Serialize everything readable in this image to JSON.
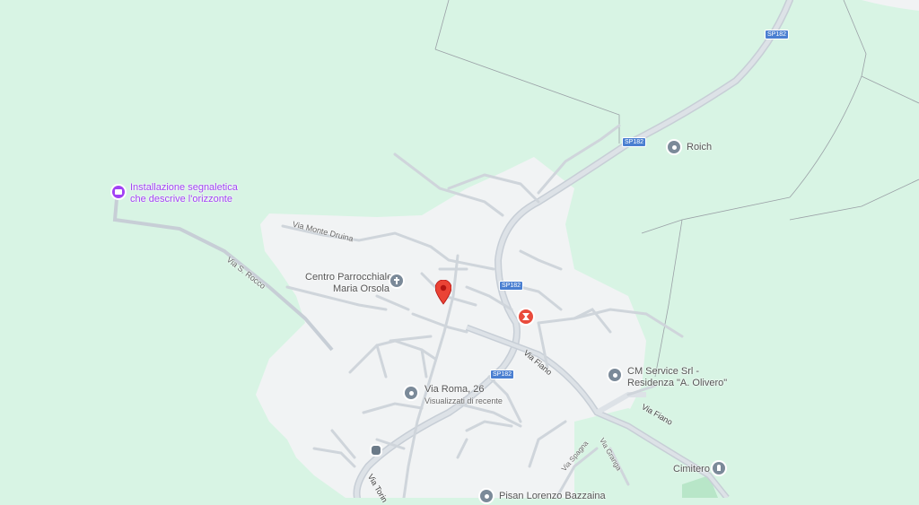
{
  "map": {
    "roads": {
      "sp182_top": "SP182",
      "sp182_mid": "SP182",
      "sp182_town": "SP182",
      "sp182_south": "SP182",
      "via_monte_druina": "Via Monte Druina",
      "via_s_rocco": "Via S. Rocco",
      "via_fiano_1": "Via Fiano",
      "via_fiano_2": "Via Fiano",
      "via_spagna": "Via Spagna",
      "via_granga": "Via Granga",
      "via_torino": "Via Torin"
    },
    "places": {
      "roich": "Roich",
      "installazione_line1": "Installazione segnaletica",
      "installazione_line2": "che descrive l'orizzonte",
      "centro_line1": "Centro Parrocchiale",
      "centro_line2": "Maria Orsola",
      "cm_service_line1": "CM Service Srl -",
      "cm_service_line2": "Residenza \"A. Olivero\"",
      "via_roma": "Via Roma, 26",
      "via_roma_sub": "Visualizzati di recente",
      "cimitero": "Cimitero",
      "bottom_cut": "Pisan Lorenzo Bazzaina"
    },
    "colors": {
      "forest": "#d8f4e4",
      "urban": "#f1f3f4",
      "road": "#c7ced6",
      "pin": "#ea4335",
      "purple": "#a142f4"
    }
  }
}
